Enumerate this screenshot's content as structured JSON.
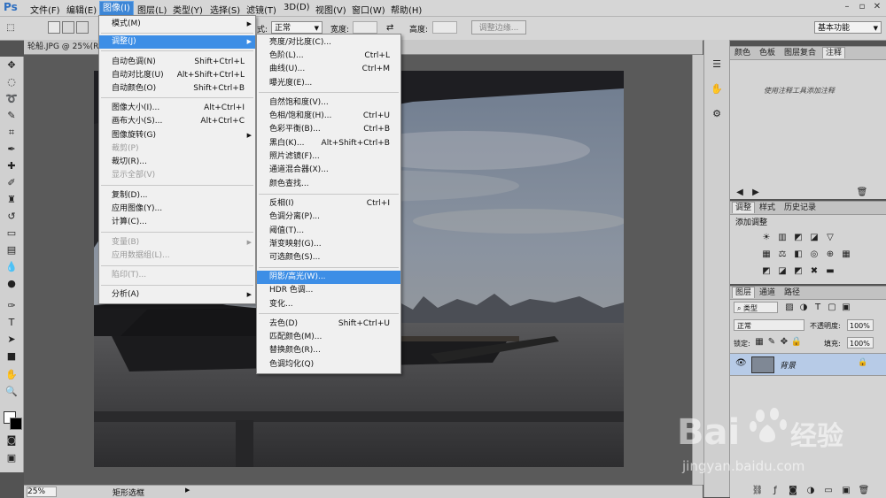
{
  "app": {
    "logo": "Ps"
  },
  "menubar": {
    "items": [
      "文件(F)",
      "编辑(E)",
      "图像(I)",
      "图层(L)",
      "类型(Y)",
      "选择(S)",
      "滤镜(T)",
      "3D(D)",
      "视图(V)",
      "窗口(W)",
      "帮助(H)"
    ],
    "active": "图像(I)"
  },
  "options": {
    "style_label": "式:",
    "style_value": "正常",
    "width_label": "宽度:",
    "height_label": "高度:",
    "refine_edge": "调整边缘...",
    "workspace": "基本功能"
  },
  "document": {
    "tab_title": "轮船.JPG @ 25%(R",
    "zoom": "25%",
    "status_tool": "矩形选框"
  },
  "image_menu": {
    "items": [
      {
        "label": "模式(M)",
        "shortcut": "",
        "submenu": true,
        "disabled": false
      },
      {
        "label": "调整(J)",
        "shortcut": "",
        "submenu": true,
        "disabled": false,
        "highlighted": true
      },
      {
        "label": "自动色调(N)",
        "shortcut": "Shift+Ctrl+L",
        "disabled": false
      },
      {
        "label": "自动对比度(U)",
        "shortcut": "Alt+Shift+Ctrl+L",
        "disabled": false
      },
      {
        "label": "自动颜色(O)",
        "shortcut": "Shift+Ctrl+B",
        "disabled": false
      },
      {
        "label": "图像大小(I)...",
        "shortcut": "Alt+Ctrl+I",
        "disabled": false
      },
      {
        "label": "画布大小(S)...",
        "shortcut": "Alt+Ctrl+C",
        "disabled": false
      },
      {
        "label": "图像旋转(G)",
        "shortcut": "",
        "submenu": true,
        "disabled": false
      },
      {
        "label": "裁剪(P)",
        "shortcut": "",
        "disabled": true
      },
      {
        "label": "裁切(R)...",
        "shortcut": "",
        "disabled": false
      },
      {
        "label": "显示全部(V)",
        "shortcut": "",
        "disabled": true
      },
      {
        "label": "复制(D)...",
        "shortcut": "",
        "disabled": false
      },
      {
        "label": "应用图像(Y)...",
        "shortcut": "",
        "disabled": false
      },
      {
        "label": "计算(C)...",
        "shortcut": "",
        "disabled": false
      },
      {
        "label": "变量(B)",
        "shortcut": "",
        "submenu": true,
        "disabled": true
      },
      {
        "label": "应用数据组(L)...",
        "shortcut": "",
        "disabled": true
      },
      {
        "label": "陷印(T)...",
        "shortcut": "",
        "disabled": true
      },
      {
        "label": "分析(A)",
        "shortcut": "",
        "submenu": true,
        "disabled": false
      }
    ]
  },
  "adjust_menu": {
    "items": [
      {
        "label": "亮度/对比度(C)...",
        "shortcut": ""
      },
      {
        "label": "色阶(L)...",
        "shortcut": "Ctrl+L"
      },
      {
        "label": "曲线(U)...",
        "shortcut": "Ctrl+M"
      },
      {
        "label": "曝光度(E)...",
        "shortcut": ""
      },
      {
        "label": "自然饱和度(V)...",
        "shortcut": ""
      },
      {
        "label": "色相/饱和度(H)...",
        "shortcut": "Ctrl+U"
      },
      {
        "label": "色彩平衡(B)...",
        "shortcut": "Ctrl+B"
      },
      {
        "label": "黑白(K)...",
        "shortcut": "Alt+Shift+Ctrl+B"
      },
      {
        "label": "照片滤镜(F)...",
        "shortcut": ""
      },
      {
        "label": "通道混合器(X)...",
        "shortcut": ""
      },
      {
        "label": "颜色查找...",
        "shortcut": ""
      },
      {
        "label": "反相(I)",
        "shortcut": "Ctrl+I"
      },
      {
        "label": "色调分离(P)...",
        "shortcut": ""
      },
      {
        "label": "阈值(T)...",
        "shortcut": ""
      },
      {
        "label": "渐变映射(G)...",
        "shortcut": ""
      },
      {
        "label": "可选颜色(S)...",
        "shortcut": ""
      },
      {
        "label": "阴影/高光(W)...",
        "shortcut": "",
        "highlighted": true
      },
      {
        "label": "HDR 色调...",
        "shortcut": ""
      },
      {
        "label": "变化...",
        "shortcut": ""
      },
      {
        "label": "去色(D)",
        "shortcut": "Shift+Ctrl+U"
      },
      {
        "label": "匹配颜色(M)...",
        "shortcut": ""
      },
      {
        "label": "替换颜色(R)...",
        "shortcut": ""
      },
      {
        "label": "色调均化(Q)",
        "shortcut": ""
      }
    ]
  },
  "panels": {
    "color_tabs": [
      "颜色",
      "色板",
      "图层复合",
      "注释"
    ],
    "color_active": "注释",
    "notes_hint": "使用注释工具添加注释",
    "adjust_tabs": [
      "调整",
      "样式",
      "历史记录"
    ],
    "adjust_active": "调整",
    "adjust_title": "添加调整",
    "layer_tabs": [
      "图层",
      "通道",
      "路径"
    ],
    "layer_active": "图层",
    "filter_kind": "类型",
    "blend_mode": "正常",
    "opacity_label": "不透明度:",
    "opacity_value": "100%",
    "lock_label": "锁定:",
    "fill_label": "填充:",
    "fill_value": "100%",
    "layer_name": "背景"
  },
  "watermark": {
    "brand": "Bai",
    "brand2": "经验",
    "url": "jingyan.baidu.com"
  },
  "colors": {
    "highlight": "#3d8ee6",
    "chrome": "#d6d6d6",
    "canvas_bg": "#5a5a5a"
  }
}
